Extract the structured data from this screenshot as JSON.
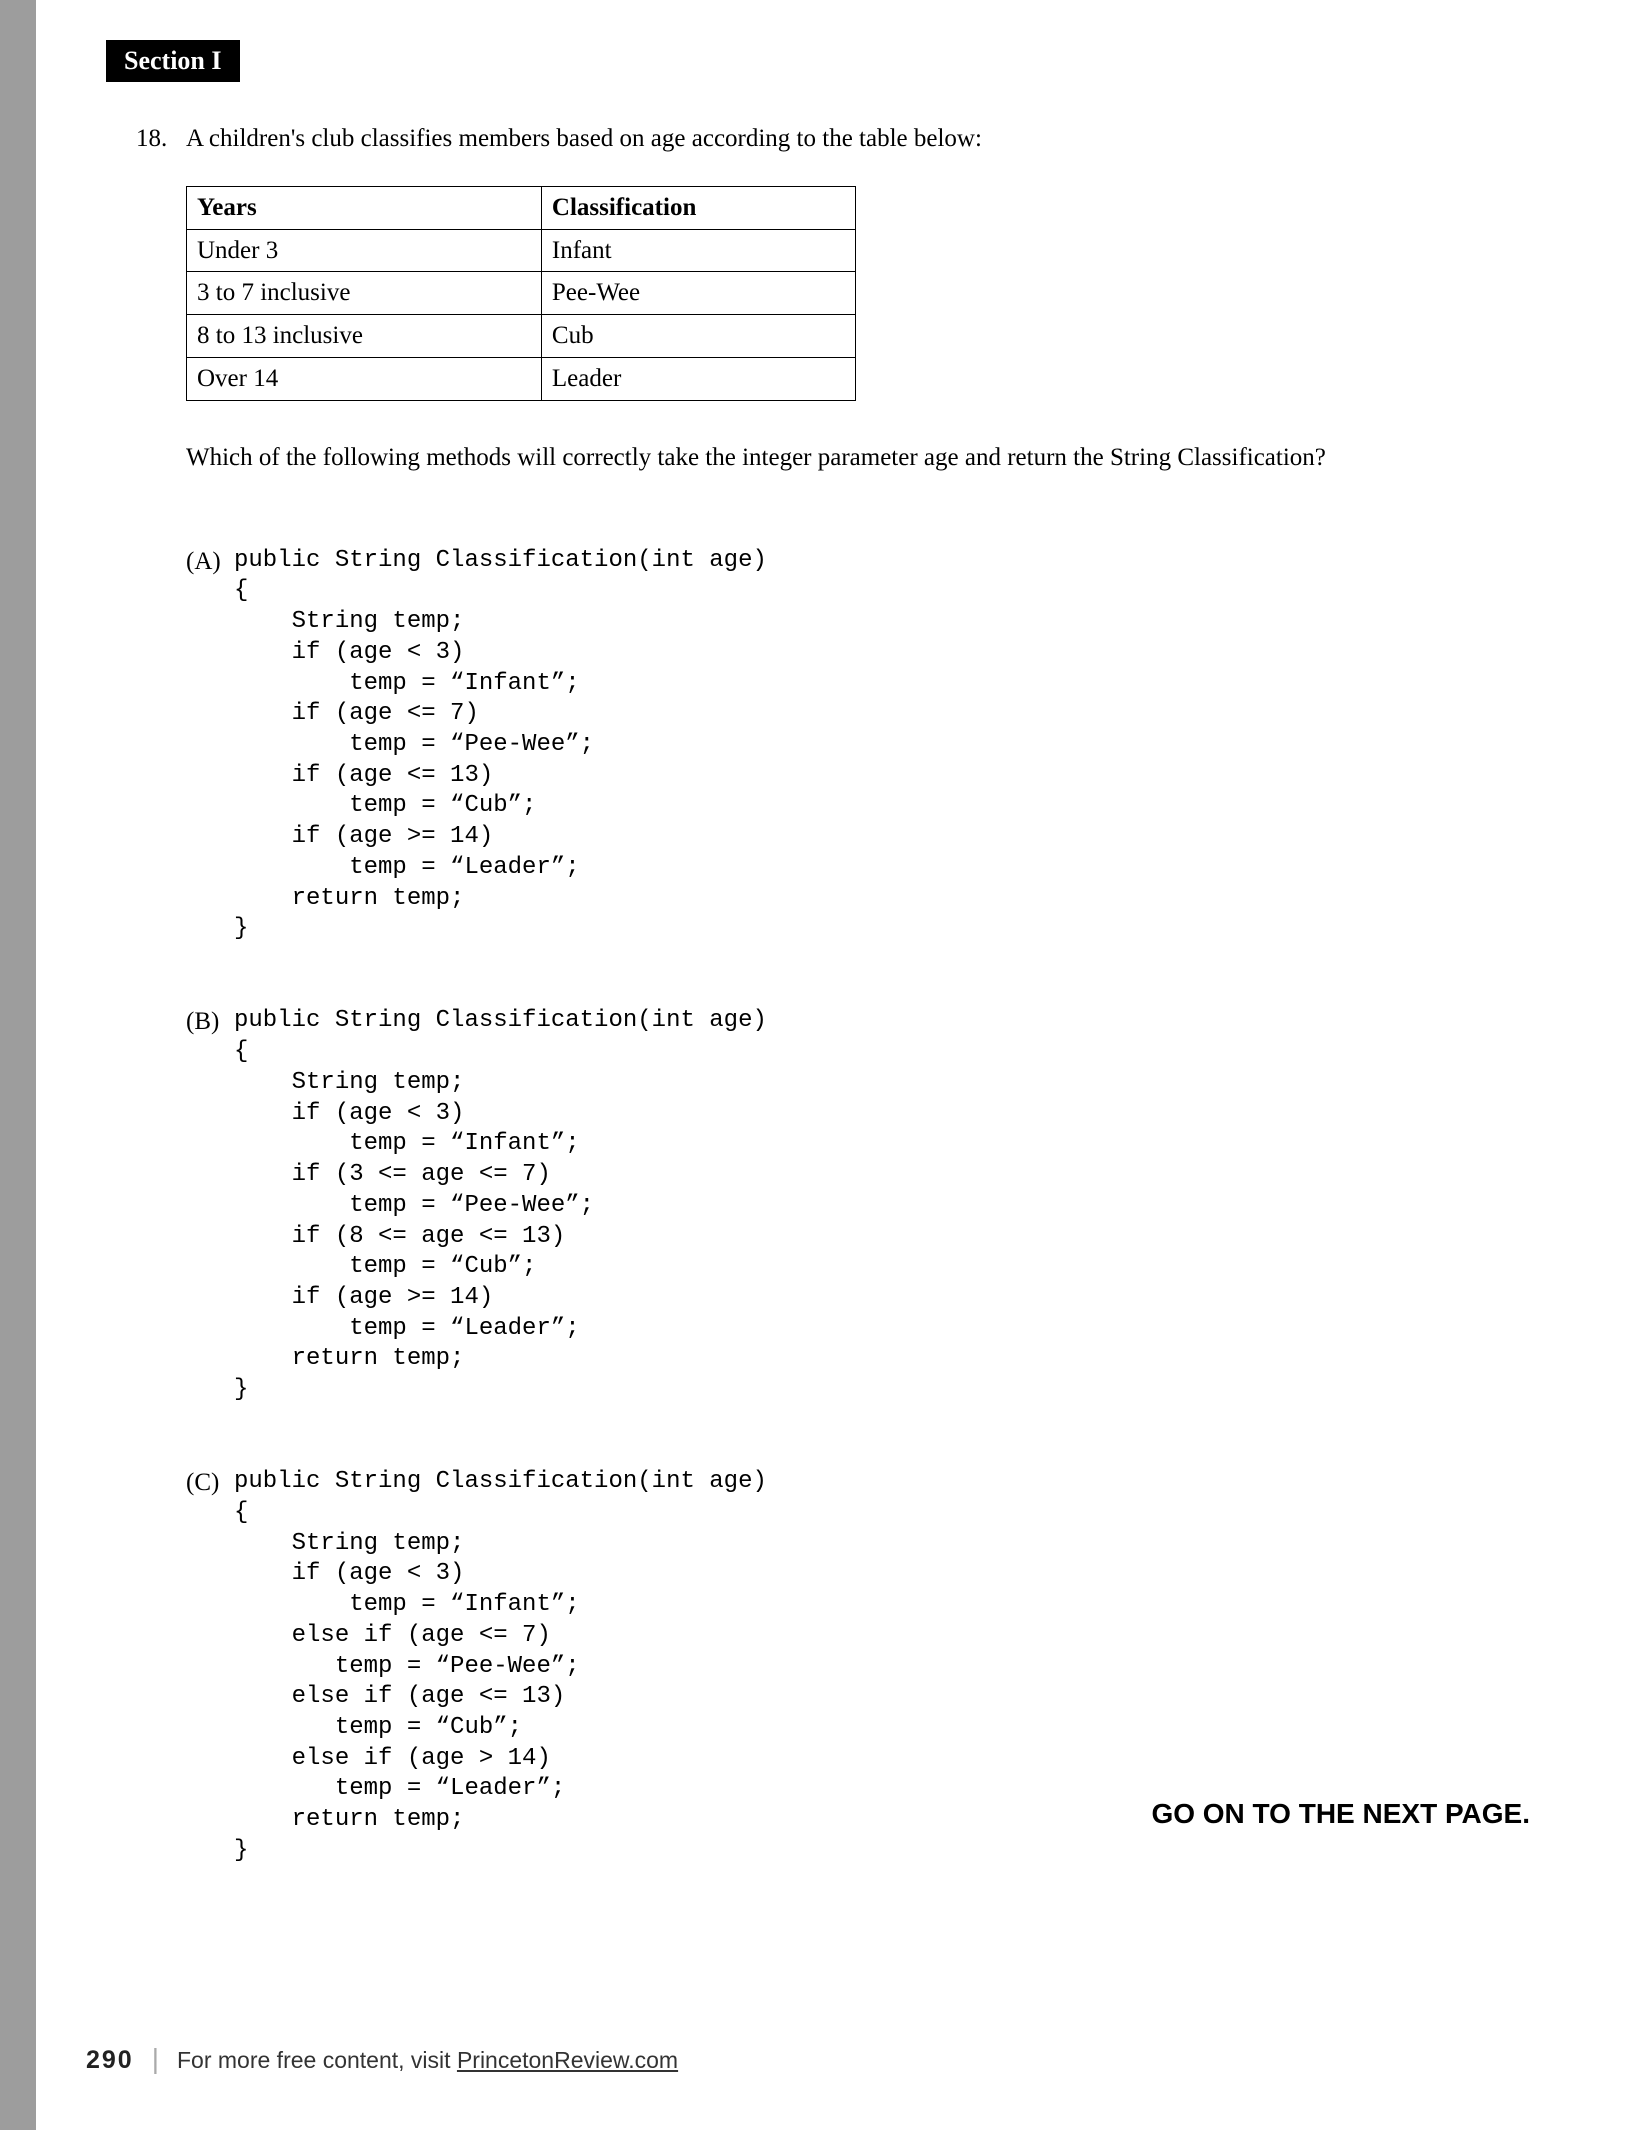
{
  "section_label": "Section I",
  "question": {
    "number": "18.",
    "prompt": "A children's club classifies members based on age according to the table below:",
    "sub_prompt": "Which of the following methods will correctly take the integer parameter age and return the String Classification?"
  },
  "table": {
    "headers": [
      "Years",
      "Classification"
    ],
    "rows": [
      [
        "Under 3",
        "Infant"
      ],
      [
        "3 to 7 inclusive",
        "Pee-Wee"
      ],
      [
        "8 to 13 inclusive",
        "Cub"
      ],
      [
        "Over 14",
        "Leader"
      ]
    ]
  },
  "choices": [
    {
      "label": "(A)",
      "code": "public String Classification(int age)\n{\n    String temp;\n    if (age < 3)\n        temp = “Infant”;\n    if (age <= 7)\n        temp = “Pee-Wee”;\n    if (age <= 13)\n        temp = “Cub”;\n    if (age >= 14)\n        temp = “Leader”;\n    return temp;\n}"
    },
    {
      "label": "(B)",
      "code": "public String Classification(int age)\n{\n    String temp;\n    if (age < 3)\n        temp = “Infant”;\n    if (3 <= age <= 7)\n        temp = “Pee-Wee”;\n    if (8 <= age <= 13)\n        temp = “Cub”;\n    if (age >= 14)\n        temp = “Leader”;\n    return temp;\n}"
    },
    {
      "label": "(C)",
      "code": "public String Classification(int age)\n{\n    String temp;\n    if (age < 3)\n        temp = “Infant”;\n    else if (age <= 7)\n       temp = “Pee-Wee”;\n    else if (age <= 13)\n       temp = “Cub”;\n    else if (age > 14)\n       temp = “Leader”;\n    return temp;\n}"
    }
  ],
  "next_page_text": "GO ON TO THE NEXT PAGE.",
  "footer": {
    "page_number": "290",
    "text_prefix": "For more free content, visit ",
    "link_text": "PrincetonReview.com"
  }
}
